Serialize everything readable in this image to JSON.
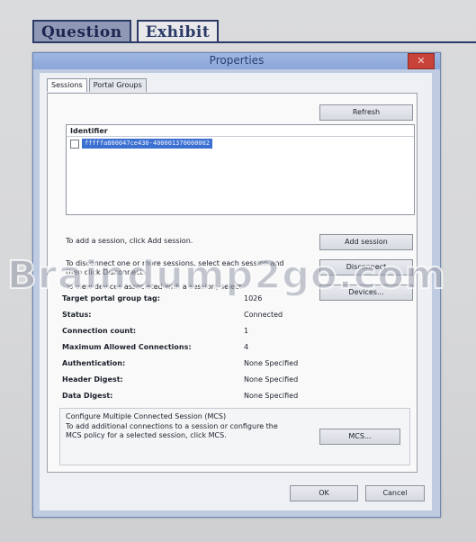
{
  "exam_tabs": {
    "question": "Question",
    "exhibit": "Exhibit"
  },
  "window": {
    "title": "Properties",
    "close_glyph": "✕"
  },
  "tabs": {
    "sessions": "Sessions",
    "portal_groups": "Portal Groups"
  },
  "sessions": {
    "refresh_label": "Refresh",
    "column_identifier": "Identifier",
    "rows": [
      {
        "identifier": "fffffa800047ce430-400001370000002"
      }
    ],
    "add_text": "To add a session, click Add session.",
    "add_button": "Add session",
    "disconnect_text": "To disconnect one or more sessions, select each session and then click Disconnect.",
    "disconnect_button": "Disconnect",
    "devices_text": "To view devices associated with a session, select",
    "devices_button": "Devices..."
  },
  "properties": [
    {
      "label": "Target portal group tag:",
      "value": "1026"
    },
    {
      "label": "Status:",
      "value": "Connected"
    },
    {
      "label": "Connection count:",
      "value": "1"
    },
    {
      "label": "Maximum Allowed Connections:",
      "value": "4"
    },
    {
      "label": "Authentication:",
      "value": "None Specified"
    },
    {
      "label": "Header Digest:",
      "value": "None Specified"
    },
    {
      "label": "Data Digest:",
      "value": "None Specified"
    }
  ],
  "mcs": {
    "title": "Configure Multiple Connected Session (MCS)",
    "description": "To add additional connections to a session or configure the MCS policy for a selected session, click MCS.",
    "button": "MCS..."
  },
  "footer": {
    "ok": "OK",
    "cancel": "Cancel"
  },
  "watermark": "Braindump2go.com",
  "colors": {
    "title_bar": "#8aa6d8",
    "close_button": "#c9423a",
    "selection": "#3b6fd0",
    "exam_tab_border": "#2b3a66"
  }
}
